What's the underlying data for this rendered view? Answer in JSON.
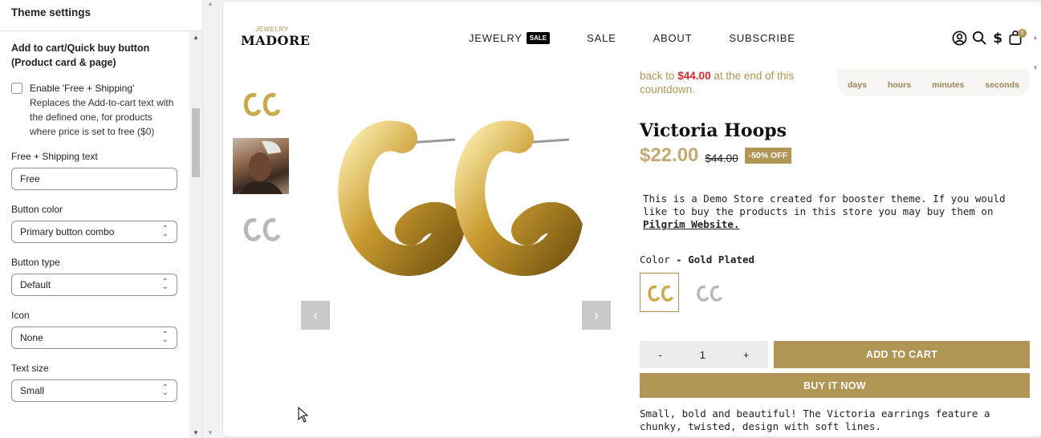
{
  "panel": {
    "title": "Theme settings",
    "section_title": "Add to cart/Quick buy button (Product card & page)",
    "enable_label": "Enable 'Free + Shipping'",
    "enable_help": "Replaces the Add-to-cart text with the defined one, for products where price is set to free ($0)",
    "free_text_label": "Free + Shipping text",
    "free_text_value": "Free",
    "button_color_label": "Button color",
    "button_color_value": "Primary button combo",
    "button_type_label": "Button type",
    "button_type_value": "Default",
    "icon_label": "Icon",
    "icon_value": "None",
    "text_size_label": "Text size",
    "text_size_value": "Small"
  },
  "store": {
    "logo_top": "JEWELRY",
    "logo_main": "MADORE",
    "menu": [
      "JEWELRY",
      "SALE",
      "ABOUT",
      "SUBSCRIBE"
    ],
    "menu_badge": "SALE",
    "cart_count": "0"
  },
  "product": {
    "countdown_pre": "back to ",
    "countdown_price": "$44.00",
    "countdown_post": " at the end of this countdown.",
    "countdown_units": [
      "days",
      "hours",
      "minutes",
      "seconds"
    ],
    "title": "Victoria Hoops",
    "price": "$22.00",
    "compare_price": "$44.00",
    "discount": "-50% OFF",
    "description": "This is a Demo Store created for booster theme. If you would like to buy the products in this store you may buy them on ",
    "description_link": "Pilgrim Website.",
    "color_label": "Color ",
    "color_value": "- Gold Plated",
    "qty_minus": "-",
    "qty_value": "1",
    "qty_plus": "+",
    "add_to_cart": "ADD TO CART",
    "buy_now": "BUY IT NOW",
    "body": "Small, bold and beautiful! The Victoria earrings feature a chunky, twisted, design with soft lines.",
    "prev_arrow": "‹",
    "next_arrow": "›"
  },
  "colors": {
    "accent": "#b09554",
    "sale_red": "#d92b2b",
    "price": "#c1aa74"
  }
}
